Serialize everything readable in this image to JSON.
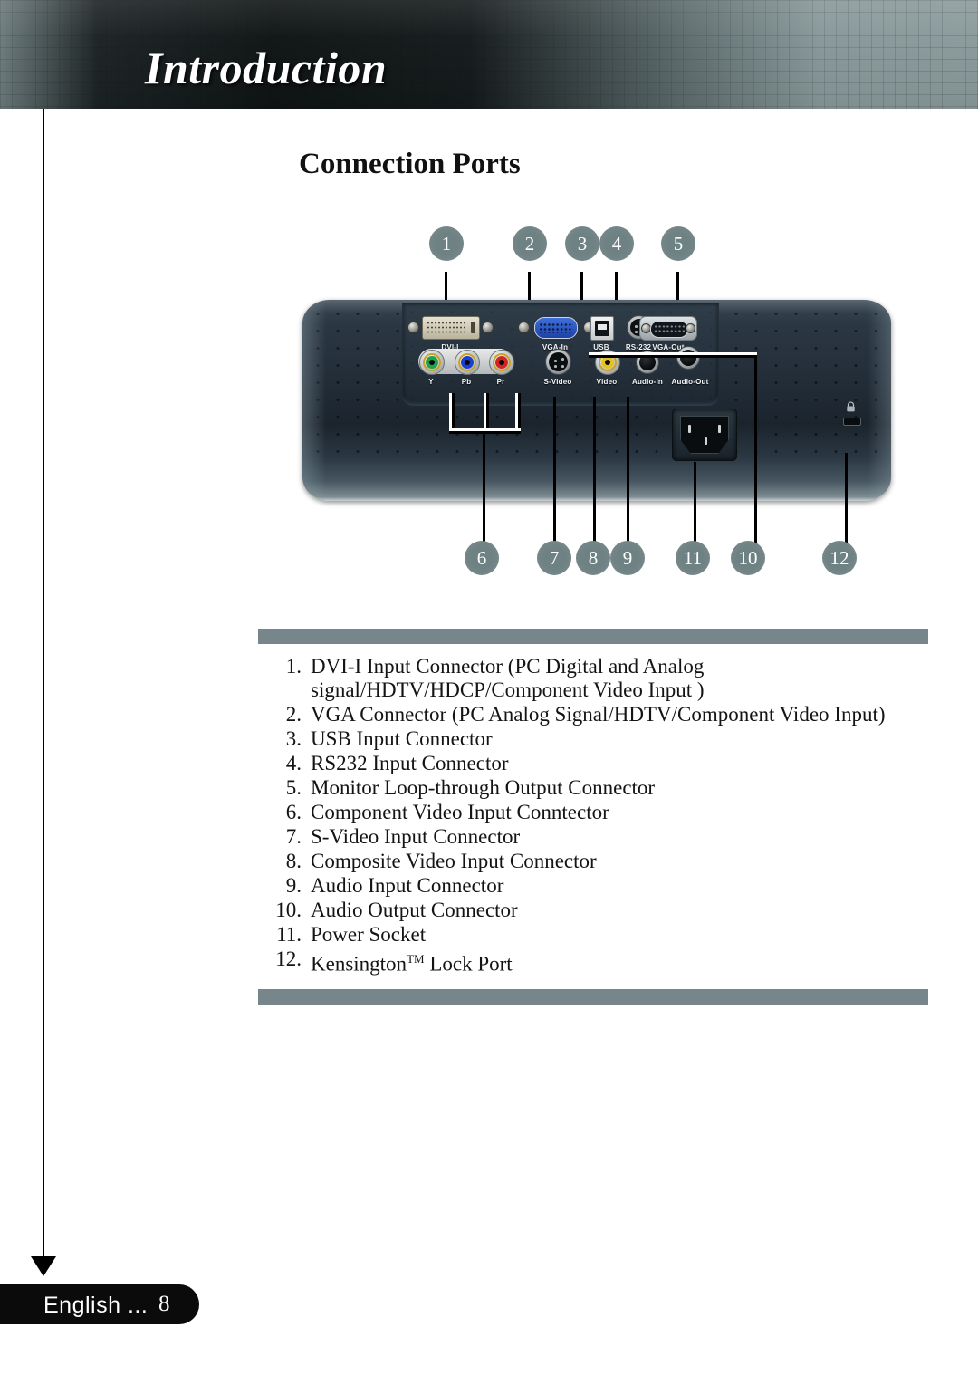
{
  "header": {
    "title": "Introduction"
  },
  "section": {
    "title": "Connection Ports"
  },
  "diagram": {
    "callouts_top": [
      {
        "n": "1"
      },
      {
        "n": "2"
      },
      {
        "n": "3"
      },
      {
        "n": "4"
      },
      {
        "n": "5"
      }
    ],
    "callouts_bottom": [
      {
        "n": "6"
      },
      {
        "n": "7"
      },
      {
        "n": "8"
      },
      {
        "n": "9"
      },
      {
        "n": "11"
      },
      {
        "n": "10"
      },
      {
        "n": "12"
      }
    ],
    "port_labels": {
      "dvi": "DVI-I",
      "vga_in": "VGA-In",
      "usb": "USB",
      "rs232": "RS-232",
      "vga_out": "VGA-Out",
      "y": "Y",
      "pb": "Pb",
      "pr": "Pr",
      "svideo": "S-Video",
      "video": "Video",
      "audio_in": "Audio-In",
      "audio_out": "Audio-Out"
    },
    "jack_colors": {
      "y": "#1ea34a",
      "pb": "#1b3fd0",
      "pr": "#d62222",
      "video": "#e8c21c",
      "vga": "#2b54bd"
    }
  },
  "list": [
    {
      "num": "1.",
      "text": "DVI-I Input Connector (PC Digital and Analog signal/HDTV/HDCP/Component Video Input )"
    },
    {
      "num": "2.",
      "text": "VGA Connector (PC Analog Signal/HDTV/Component Video Input)"
    },
    {
      "num": "3.",
      "text": "USB Input Connector"
    },
    {
      "num": "4.",
      "text": "RS232 Input Connector"
    },
    {
      "num": "5.",
      "text": "Monitor Loop-through Output Connector"
    },
    {
      "num": "6.",
      "text": "Component Video Input Conntector"
    },
    {
      "num": "7.",
      "text": "S-Video Input Connector"
    },
    {
      "num": "8.",
      "text": "Composite Video Input Connector"
    },
    {
      "num": "9.",
      "text": "Audio Input Connector"
    },
    {
      "num": "10.",
      "text": "Audio Output Connector"
    },
    {
      "num": "11.",
      "text": "Power  Socket"
    },
    {
      "num": "12.",
      "text": "Kensington<sup>TM</sup> Lock Port",
      "html": true
    }
  ],
  "footer": {
    "label": "English ...",
    "page": "8"
  },
  "colors": {
    "accent_bar": "#76868a",
    "callout": "#6e8183",
    "header_dark": "#0d1415"
  }
}
